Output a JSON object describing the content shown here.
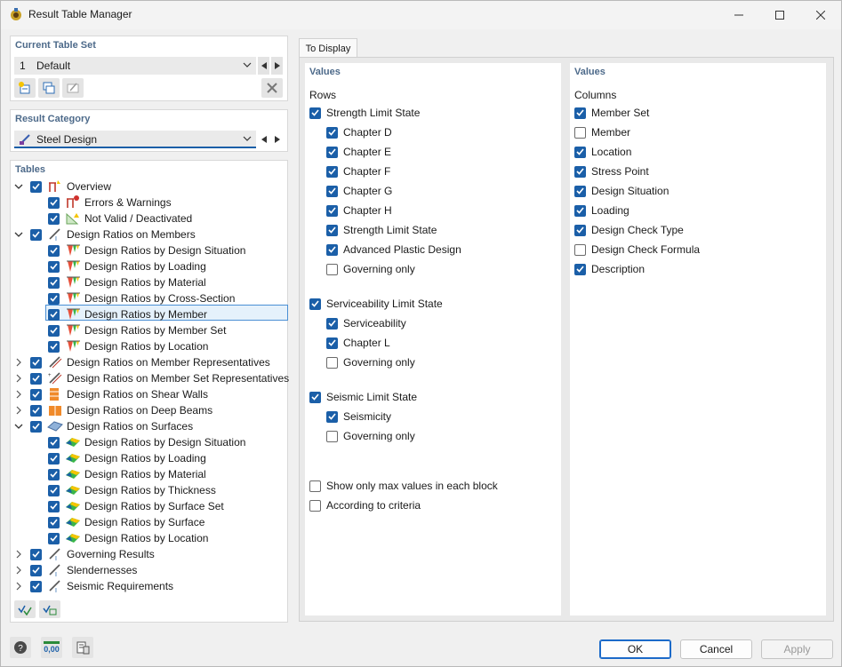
{
  "window": {
    "title": "Result Table Manager"
  },
  "current_table_set": {
    "title": "Current Table Set",
    "number": "1",
    "value": "Default"
  },
  "result_category": {
    "title": "Result Category",
    "value": "Steel Design"
  },
  "tables": {
    "title": "Tables",
    "items": [
      {
        "label": "Overview",
        "icon": "overview-icon"
      },
      {
        "label": "Errors & Warnings",
        "icon": "errors-warnings-icon"
      },
      {
        "label": "Not Valid / Deactivated",
        "icon": "not-valid-icon"
      },
      {
        "label": "Design Ratios on Members",
        "icon": "member-icon"
      },
      {
        "label": "Design Ratios by Design Situation",
        "icon": "ratio-icon"
      },
      {
        "label": "Design Ratios by Loading",
        "icon": "ratio-icon"
      },
      {
        "label": "Design Ratios by Material",
        "icon": "ratio-icon"
      },
      {
        "label": "Design Ratios by Cross-Section",
        "icon": "ratio-icon"
      },
      {
        "label": "Design Ratios by Member",
        "icon": "ratio-icon"
      },
      {
        "label": "Design Ratios by Member Set",
        "icon": "ratio-icon"
      },
      {
        "label": "Design Ratios by Location",
        "icon": "ratio-icon"
      },
      {
        "label": "Design Ratios on Member Representatives",
        "icon": "member-rep-icon"
      },
      {
        "label": "Design Ratios on Member Set Representatives",
        "icon": "member-set-rep-icon"
      },
      {
        "label": "Design Ratios on Shear Walls",
        "icon": "shear-wall-icon"
      },
      {
        "label": "Design Ratios on Deep Beams",
        "icon": "deep-beam-icon"
      },
      {
        "label": "Design Ratios on Surfaces",
        "icon": "surface-icon"
      },
      {
        "label": "Design Ratios by Design Situation",
        "icon": "surface-ratio-icon"
      },
      {
        "label": "Design Ratios by Loading",
        "icon": "surface-ratio-icon"
      },
      {
        "label": "Design Ratios by Material",
        "icon": "surface-ratio-icon"
      },
      {
        "label": "Design Ratios by Thickness",
        "icon": "surface-ratio-icon"
      },
      {
        "label": "Design Ratios by Surface Set",
        "icon": "surface-ratio-icon"
      },
      {
        "label": "Design Ratios by Surface",
        "icon": "surface-ratio-icon"
      },
      {
        "label": "Design Ratios by Location",
        "icon": "surface-ratio-icon"
      },
      {
        "label": "Governing Results",
        "icon": "member-icon"
      },
      {
        "label": "Slendernesses",
        "icon": "member-icon"
      },
      {
        "label": "Seismic Requirements",
        "icon": "member-icon"
      }
    ]
  },
  "tab": {
    "label": "To Display"
  },
  "rows_panel": {
    "title": "Values",
    "subtitle": "Rows",
    "strength": {
      "label": "Strength Limit State",
      "children": [
        "Chapter D",
        "Chapter E",
        "Chapter F",
        "Chapter G",
        "Chapter H",
        "Strength Limit State",
        "Advanced Plastic Design",
        "Governing only"
      ]
    },
    "serviceability": {
      "label": "Serviceability Limit State",
      "children": [
        "Serviceability",
        "Chapter L",
        "Governing only"
      ]
    },
    "seismic": {
      "label": "Seismic Limit State",
      "children": [
        "Seismicity",
        "Governing only"
      ]
    },
    "show_max": "Show only max values in each block",
    "according": "According to criteria"
  },
  "columns_panel": {
    "title": "Values",
    "subtitle": "Columns",
    "items": [
      "Member Set",
      "Member",
      "Location",
      "Stress Point",
      "Design Situation",
      "Loading",
      "Design Check Type",
      "Design Check Formula",
      "Description"
    ]
  },
  "buttons": {
    "ok": "OK",
    "cancel": "Cancel",
    "apply": "Apply"
  },
  "bottom_value": "0,00",
  "colors": {
    "accent": "#1b5fa8",
    "section_title": "#4d6a8a"
  }
}
